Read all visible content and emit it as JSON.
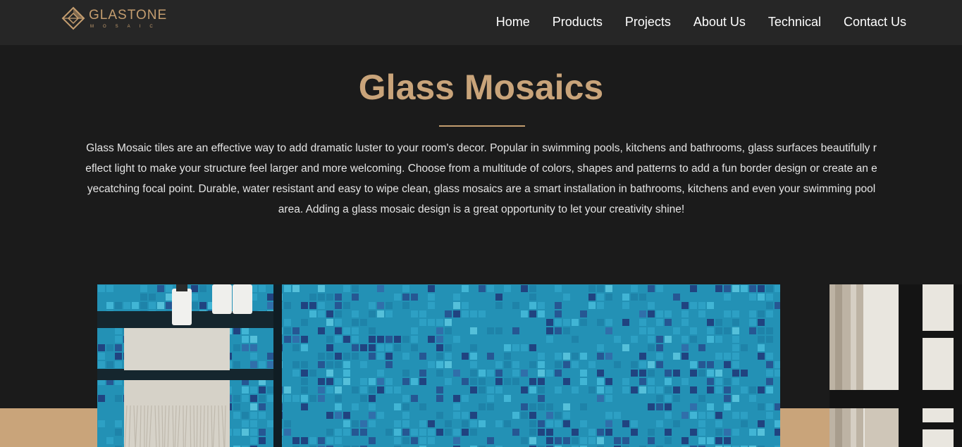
{
  "header": {
    "logo": {
      "name": "GLASTONE",
      "tagline": "MOSAIC",
      "color": "#c49d6f"
    },
    "nav": [
      {
        "label": "Home"
      },
      {
        "label": "Products"
      },
      {
        "label": "Projects"
      },
      {
        "label": "About Us"
      },
      {
        "label": "Technical"
      },
      {
        "label": "Contact Us"
      }
    ]
  },
  "intro": {
    "title": "Glass Mosaics",
    "description": "Glass Mosaic tiles are an effective way to add dramatic luster to your room's decor. Popular in swimming pools, kitchens and bathrooms, glass surfaces beautifully reflect light to make your structure feel larger and more welcoming. Choose from a multitude of colors, shapes and patterns to add a fun border design or create an eyecatching focal point. Durable, water resistant and easy to wipe clean, glass mosaics are a smart installation in bathrooms, kitchens and even your swimming pool area. Adding a glass mosaic design is a great opportunity to let your creativity shine!"
  },
  "colors": {
    "background": "#1b1b1b",
    "header": "#262626",
    "accent": "#c9a47a",
    "tile_primary": "#1f8fb3",
    "tile_dark": "#1c3a7a",
    "tile_light": "#3fb6d6"
  },
  "gallery": {
    "slides": [
      {
        "name": "blue-mosaic-bathroom-photo"
      },
      {
        "name": "window-frame-photo"
      }
    ]
  }
}
